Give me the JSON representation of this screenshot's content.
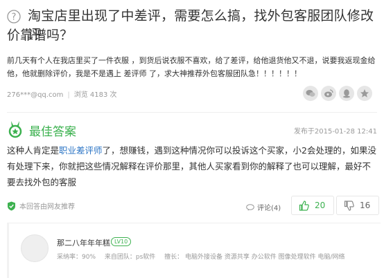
{
  "question": {
    "title_line1": "淘宝店里出现了中差评，需要怎么搞，找外包客服团队修改评",
    "title_line2": "价靠谱吗？",
    "body": "前几天有个人在我店里买了一件衣服 ，到货后说衣服不喜欢，给了差评，给他退货他又不退，说要我返现金给他，他就删除评价，我是不是遇上 差评师 了，求大神推荐外包客服团队急！！！！！！",
    "asker": "276***@qq.com",
    "views": "浏览 4183 次"
  },
  "best_answer": {
    "label": "最佳答案",
    "time": "发布于2015-01-28 12:41",
    "text_before_link": "这种人肯定是",
    "link_text": "职业差评师",
    "text_after_link": "了，想赚钱，遇到这种情况你可以投诉这个买家，小2会处理的，如果没有处理下来，你就把这些情况解释在评价那里，其他人买家看到你的解释了也可以理解，最好不要去找外包的客服",
    "verified": "本回答由网友推荐",
    "comments": "评论(4)",
    "upvotes": "20",
    "downvotes": "16"
  },
  "answerer": {
    "name": "那二八年年年糕",
    "level": "LV10",
    "adoption": "采纳率：90%",
    "team": "来自团队：ps软件",
    "expertise": "擅长： 电脑外接设备  资源共享  办公软件  图像处理软件  电脑/网络"
  },
  "colors": {
    "accent_green": "#3cb14f",
    "link_blue": "#2c75c5"
  }
}
